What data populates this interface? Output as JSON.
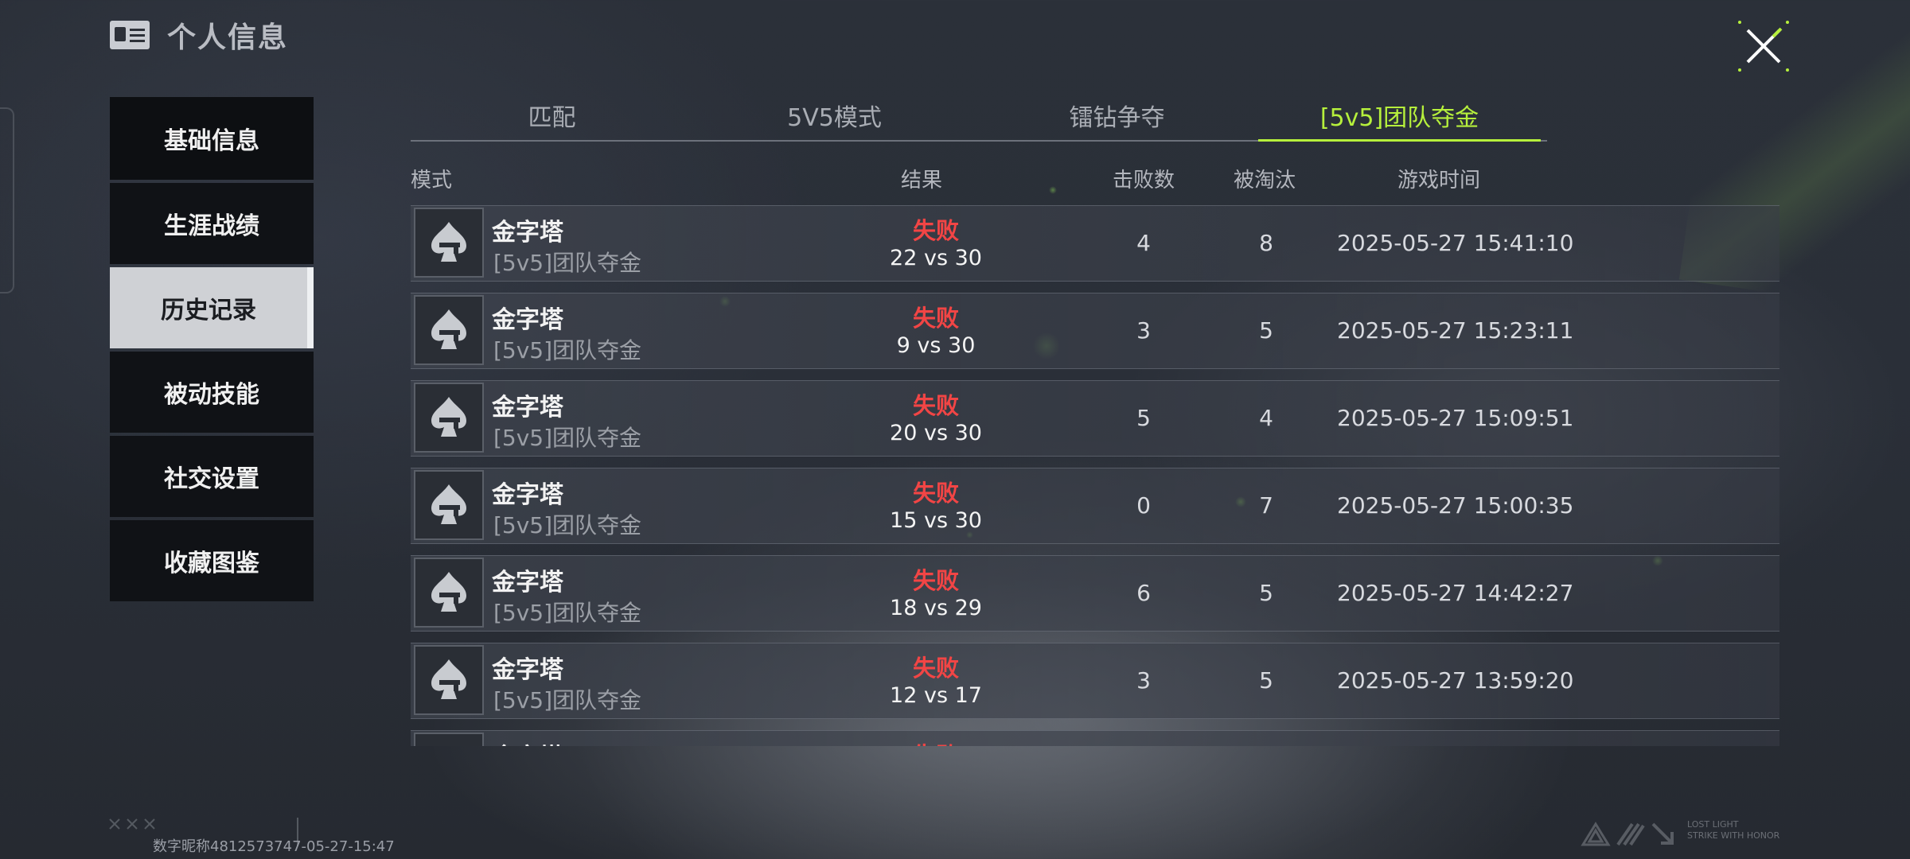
{
  "header": {
    "title": "个人信息",
    "icon": "id-card-icon"
  },
  "close_icon": "close-icon",
  "sidebar": {
    "items": [
      {
        "label": "基础信息"
      },
      {
        "label": "生涯战绩"
      },
      {
        "label": "历史记录",
        "active": true
      },
      {
        "label": "被动技能"
      },
      {
        "label": "社交设置"
      },
      {
        "label": "收藏图鉴"
      }
    ]
  },
  "tabs": [
    {
      "label": "匹配"
    },
    {
      "label": "5V5模式"
    },
    {
      "label": "镭钻争夺"
    },
    {
      "label": "[5v5]团队夺金",
      "active": true
    }
  ],
  "table": {
    "headers": {
      "mode": "模式",
      "result": "结果",
      "kills": "击败数",
      "deaths": "被淘汰",
      "time": "游戏时间"
    },
    "rows": [
      {
        "map": "金字塔",
        "mode": "[5v5]团队夺金",
        "result": "失败",
        "score": "22 vs 30",
        "kills": "4",
        "deaths": "8",
        "time": "2025-05-27 15:41:10"
      },
      {
        "map": "金字塔",
        "mode": "[5v5]团队夺金",
        "result": "失败",
        "score": "9 vs 30",
        "kills": "3",
        "deaths": "5",
        "time": "2025-05-27 15:23:11"
      },
      {
        "map": "金字塔",
        "mode": "[5v5]团队夺金",
        "result": "失败",
        "score": "20 vs 30",
        "kills": "5",
        "deaths": "4",
        "time": "2025-05-27 15:09:51"
      },
      {
        "map": "金字塔",
        "mode": "[5v5]团队夺金",
        "result": "失败",
        "score": "15 vs 30",
        "kills": "0",
        "deaths": "7",
        "time": "2025-05-27 15:00:35"
      },
      {
        "map": "金字塔",
        "mode": "[5v5]团队夺金",
        "result": "失败",
        "score": "18 vs 29",
        "kills": "6",
        "deaths": "5",
        "time": "2025-05-27 14:42:27"
      },
      {
        "map": "金字塔",
        "mode": "[5v5]团队夺金",
        "result": "失败",
        "score": "12 vs 17",
        "kills": "3",
        "deaths": "5",
        "time": "2025-05-27 13:59:20"
      },
      {
        "map": "金字塔",
        "mode": "",
        "result": "失败",
        "score": "",
        "kills": "",
        "deaths": "",
        "time": ""
      }
    ],
    "row_icon": "spade-gun-icon"
  },
  "footer": {
    "watermark": "数字昵称4812573747-05-27-15:47",
    "brand_text_line1": "LOST LIGHT",
    "brand_text_line2": "STRIKE WITH HONOR"
  },
  "colors": {
    "accent": "#b6f03c",
    "lose": "#f24545",
    "sidebar_active_bg": "#cfd1d5"
  }
}
